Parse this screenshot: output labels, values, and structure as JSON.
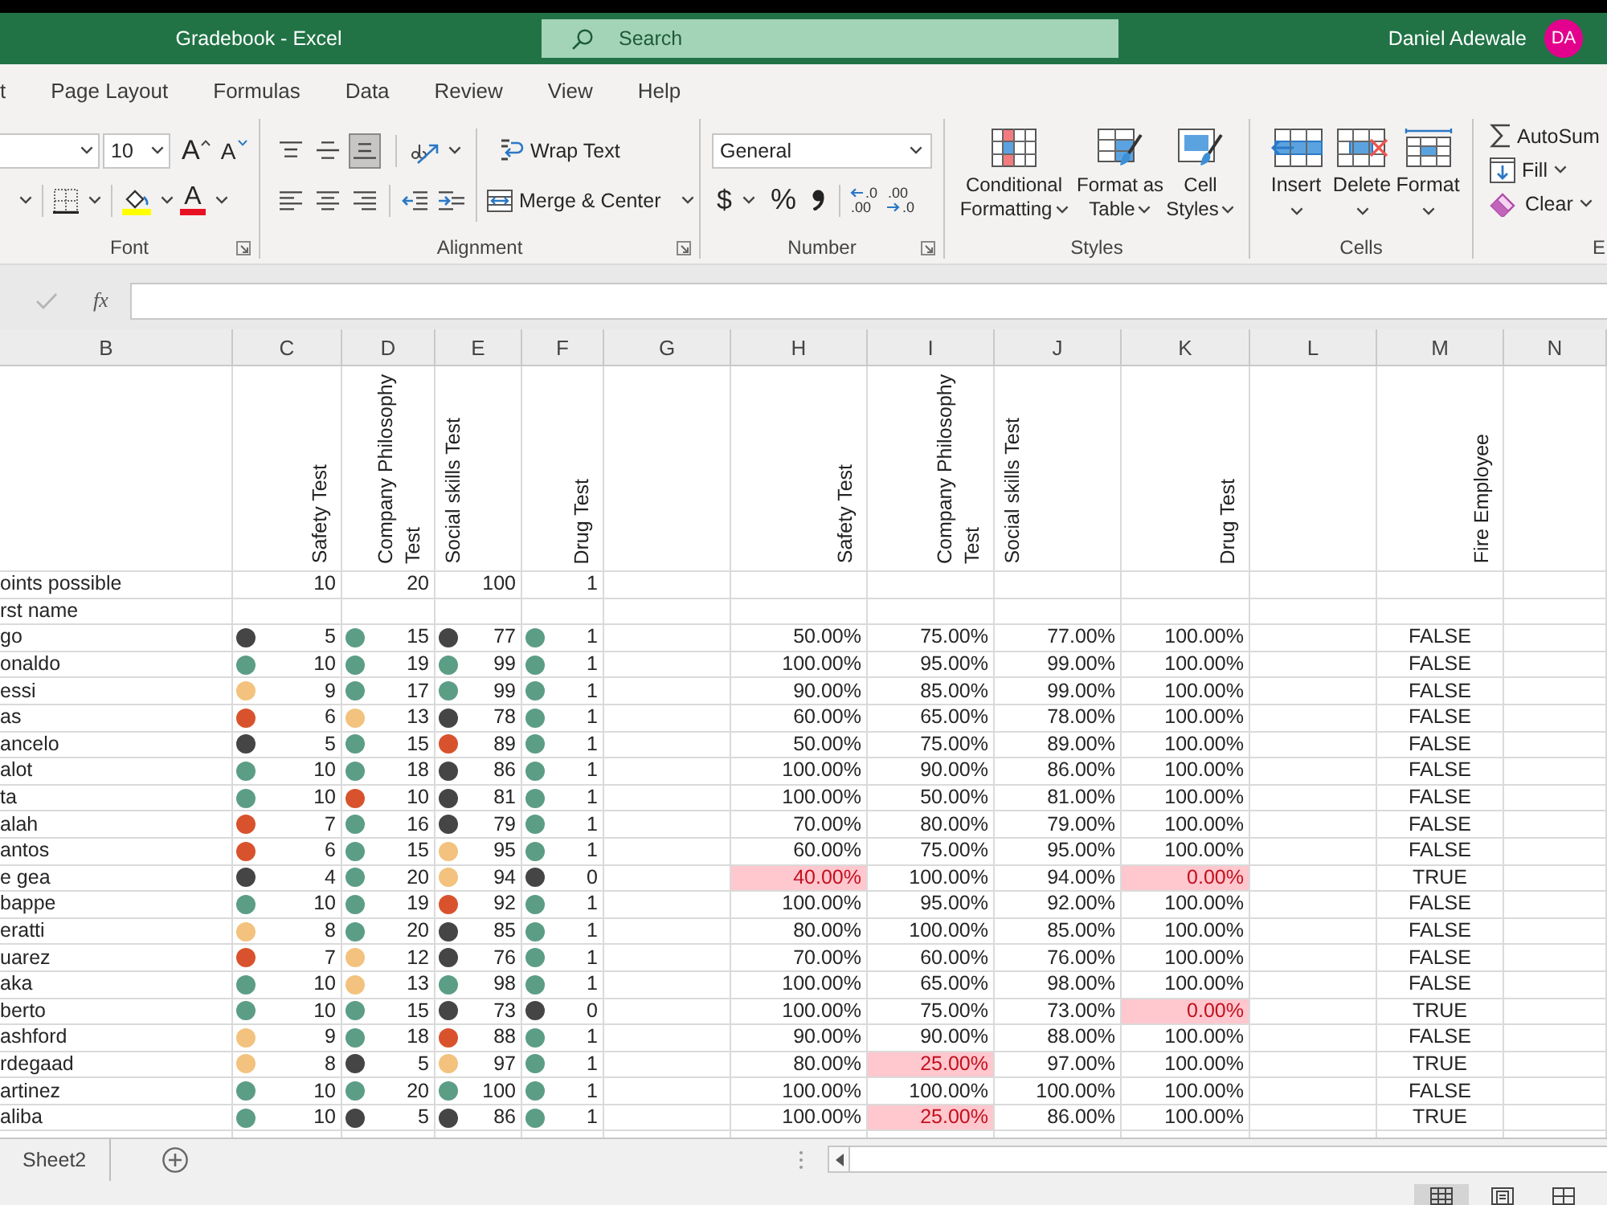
{
  "window": {
    "title": "Gradebook - Excel",
    "search": {
      "placeholder": "Search"
    },
    "user": {
      "name": "Daniel Adewale",
      "initials": "DA"
    }
  },
  "menu_tabs": [
    "t",
    "Page Layout",
    "Formulas",
    "Data",
    "Review",
    "View",
    "Help"
  ],
  "ribbon": {
    "font": {
      "label": "Font",
      "size": "10",
      "grow": "A",
      "shrink": "A",
      "font_color": "A"
    },
    "alignment": {
      "label": "Alignment",
      "vertical": [
        {
          "kind": "top",
          "selected": false
        },
        {
          "kind": "middle",
          "selected": false
        },
        {
          "kind": "bottom",
          "selected": true
        }
      ],
      "wrap_text": "Wrap Text",
      "merge": "Merge & Center"
    },
    "number": {
      "label": "Number",
      "format": "General",
      "currency": "$",
      "percent": "%",
      "decimals": [
        {
          "kind": "increase",
          "top": ".0",
          "bottom": ".00"
        },
        {
          "kind": "decrease",
          "top": ".00",
          "bottom": ".0"
        }
      ]
    },
    "styles": {
      "label": "Styles",
      "buttons": [
        {
          "kind": "conditional",
          "label": "Conditional Formatting"
        },
        {
          "kind": "table",
          "label": "Format as Table"
        },
        {
          "kind": "cell",
          "label": "Cell Styles"
        }
      ]
    },
    "cells": {
      "label": "Cells",
      "buttons": [
        {
          "kind": "insert",
          "label": "Insert"
        },
        {
          "kind": "delete",
          "label": "Delete"
        },
        {
          "kind": "format",
          "label": "Format"
        }
      ]
    },
    "editing": {
      "label": "E",
      "buttons": [
        {
          "kind": "autosum",
          "label": "AutoSum"
        },
        {
          "kind": "fill",
          "label": "Fill"
        },
        {
          "kind": "clear",
          "label": "Clear"
        }
      ]
    }
  },
  "formula_bar": {
    "function_label": "fx"
  },
  "sheet": {
    "columns": [
      "B",
      "C",
      "D",
      "E",
      "F",
      "G",
      "H",
      "I",
      "J",
      "K",
      "L",
      "M",
      "N"
    ],
    "score_headers": [
      "Safety Test",
      "Company Philosophy Test",
      "Social skills Test",
      "Drug Test"
    ],
    "percent_headers": [
      "Safety Test",
      "Company Philosophy Test",
      "Social skills Test",
      "Drug Test"
    ],
    "result_header": "Fire Employee",
    "points_row": {
      "label": "oints possible",
      "values": [
        "10",
        "20",
        "100",
        "1"
      ]
    },
    "name_row": {
      "label": "rst name"
    },
    "rows": [
      {
        "name": "go",
        "scores": [
          {
            "value": "5",
            "color": "#454545"
          },
          {
            "value": "15",
            "color": "#5c9d86"
          },
          {
            "value": "77",
            "color": "#454545"
          },
          {
            "value": "1",
            "color": "#5c9d86"
          }
        ],
        "percents": [
          {
            "text": "50.00%",
            "flagged": false
          },
          {
            "text": "75.00%",
            "flagged": false
          },
          {
            "text": "77.00%",
            "flagged": false
          },
          {
            "text": "100.00%",
            "flagged": false
          }
        ],
        "result": "FALSE"
      },
      {
        "name": "onaldo",
        "scores": [
          {
            "value": "10",
            "color": "#5c9d86"
          },
          {
            "value": "19",
            "color": "#5c9d86"
          },
          {
            "value": "99",
            "color": "#5c9d86"
          },
          {
            "value": "1",
            "color": "#5c9d86"
          }
        ],
        "percents": [
          {
            "text": "100.00%",
            "flagged": false
          },
          {
            "text": "95.00%",
            "flagged": false
          },
          {
            "text": "99.00%",
            "flagged": false
          },
          {
            "text": "100.00%",
            "flagged": false
          }
        ],
        "result": "FALSE"
      },
      {
        "name": "essi",
        "scores": [
          {
            "value": "9",
            "color": "#f2c27e"
          },
          {
            "value": "17",
            "color": "#5c9d86"
          },
          {
            "value": "99",
            "color": "#5c9d86"
          },
          {
            "value": "1",
            "color": "#5c9d86"
          }
        ],
        "percents": [
          {
            "text": "90.00%",
            "flagged": false
          },
          {
            "text": "85.00%",
            "flagged": false
          },
          {
            "text": "99.00%",
            "flagged": false
          },
          {
            "text": "100.00%",
            "flagged": false
          }
        ],
        "result": "FALSE"
      },
      {
        "name": "as",
        "scores": [
          {
            "value": "6",
            "color": "#d8532d"
          },
          {
            "value": "13",
            "color": "#f2c27e"
          },
          {
            "value": "78",
            "color": "#454545"
          },
          {
            "value": "1",
            "color": "#5c9d86"
          }
        ],
        "percents": [
          {
            "text": "60.00%",
            "flagged": false
          },
          {
            "text": "65.00%",
            "flagged": false
          },
          {
            "text": "78.00%",
            "flagged": false
          },
          {
            "text": "100.00%",
            "flagged": false
          }
        ],
        "result": "FALSE"
      },
      {
        "name": "ancelo",
        "scores": [
          {
            "value": "5",
            "color": "#454545"
          },
          {
            "value": "15",
            "color": "#5c9d86"
          },
          {
            "value": "89",
            "color": "#d8532d"
          },
          {
            "value": "1",
            "color": "#5c9d86"
          }
        ],
        "percents": [
          {
            "text": "50.00%",
            "flagged": false
          },
          {
            "text": "75.00%",
            "flagged": false
          },
          {
            "text": "89.00%",
            "flagged": false
          },
          {
            "text": "100.00%",
            "flagged": false
          }
        ],
        "result": "FALSE"
      },
      {
        "name": "alot",
        "scores": [
          {
            "value": "10",
            "color": "#5c9d86"
          },
          {
            "value": "18",
            "color": "#5c9d86"
          },
          {
            "value": "86",
            "color": "#454545"
          },
          {
            "value": "1",
            "color": "#5c9d86"
          }
        ],
        "percents": [
          {
            "text": "100.00%",
            "flagged": false
          },
          {
            "text": "90.00%",
            "flagged": false
          },
          {
            "text": "86.00%",
            "flagged": false
          },
          {
            "text": "100.00%",
            "flagged": false
          }
        ],
        "result": "FALSE"
      },
      {
        "name": "ta",
        "scores": [
          {
            "value": "10",
            "color": "#5c9d86"
          },
          {
            "value": "10",
            "color": "#d8532d"
          },
          {
            "value": "81",
            "color": "#454545"
          },
          {
            "value": "1",
            "color": "#5c9d86"
          }
        ],
        "percents": [
          {
            "text": "100.00%",
            "flagged": false
          },
          {
            "text": "50.00%",
            "flagged": false
          },
          {
            "text": "81.00%",
            "flagged": false
          },
          {
            "text": "100.00%",
            "flagged": false
          }
        ],
        "result": "FALSE"
      },
      {
        "name": "alah",
        "scores": [
          {
            "value": "7",
            "color": "#d8532d"
          },
          {
            "value": "16",
            "color": "#5c9d86"
          },
          {
            "value": "79",
            "color": "#454545"
          },
          {
            "value": "1",
            "color": "#5c9d86"
          }
        ],
        "percents": [
          {
            "text": "70.00%",
            "flagged": false
          },
          {
            "text": "80.00%",
            "flagged": false
          },
          {
            "text": "79.00%",
            "flagged": false
          },
          {
            "text": "100.00%",
            "flagged": false
          }
        ],
        "result": "FALSE"
      },
      {
        "name": "antos",
        "scores": [
          {
            "value": "6",
            "color": "#d8532d"
          },
          {
            "value": "15",
            "color": "#5c9d86"
          },
          {
            "value": "95",
            "color": "#f2c27e"
          },
          {
            "value": "1",
            "color": "#5c9d86"
          }
        ],
        "percents": [
          {
            "text": "60.00%",
            "flagged": false
          },
          {
            "text": "75.00%",
            "flagged": false
          },
          {
            "text": "95.00%",
            "flagged": false
          },
          {
            "text": "100.00%",
            "flagged": false
          }
        ],
        "result": "FALSE"
      },
      {
        "name": "e gea",
        "scores": [
          {
            "value": "4",
            "color": "#454545"
          },
          {
            "value": "20",
            "color": "#5c9d86"
          },
          {
            "value": "94",
            "color": "#f2c27e"
          },
          {
            "value": "0",
            "color": "#454545"
          }
        ],
        "percents": [
          {
            "text": "40.00%",
            "flagged": true
          },
          {
            "text": "100.00%",
            "flagged": false
          },
          {
            "text": "94.00%",
            "flagged": false
          },
          {
            "text": "0.00%",
            "flagged": true
          }
        ],
        "result": "TRUE"
      },
      {
        "name": "bappe",
        "scores": [
          {
            "value": "10",
            "color": "#5c9d86"
          },
          {
            "value": "19",
            "color": "#5c9d86"
          },
          {
            "value": "92",
            "color": "#d8532d"
          },
          {
            "value": "1",
            "color": "#5c9d86"
          }
        ],
        "percents": [
          {
            "text": "100.00%",
            "flagged": false
          },
          {
            "text": "95.00%",
            "flagged": false
          },
          {
            "text": "92.00%",
            "flagged": false
          },
          {
            "text": "100.00%",
            "flagged": false
          }
        ],
        "result": "FALSE"
      },
      {
        "name": "eratti",
        "scores": [
          {
            "value": "8",
            "color": "#f2c27e"
          },
          {
            "value": "20",
            "color": "#5c9d86"
          },
          {
            "value": "85",
            "color": "#454545"
          },
          {
            "value": "1",
            "color": "#5c9d86"
          }
        ],
        "percents": [
          {
            "text": "80.00%",
            "flagged": false
          },
          {
            "text": "100.00%",
            "flagged": false
          },
          {
            "text": "85.00%",
            "flagged": false
          },
          {
            "text": "100.00%",
            "flagged": false
          }
        ],
        "result": "FALSE"
      },
      {
        "name": "uarez",
        "scores": [
          {
            "value": "7",
            "color": "#d8532d"
          },
          {
            "value": "12",
            "color": "#f2c27e"
          },
          {
            "value": "76",
            "color": "#454545"
          },
          {
            "value": "1",
            "color": "#5c9d86"
          }
        ],
        "percents": [
          {
            "text": "70.00%",
            "flagged": false
          },
          {
            "text": "60.00%",
            "flagged": false
          },
          {
            "text": "76.00%",
            "flagged": false
          },
          {
            "text": "100.00%",
            "flagged": false
          }
        ],
        "result": "FALSE"
      },
      {
        "name": "aka",
        "scores": [
          {
            "value": "10",
            "color": "#5c9d86"
          },
          {
            "value": "13",
            "color": "#f2c27e"
          },
          {
            "value": "98",
            "color": "#5c9d86"
          },
          {
            "value": "1",
            "color": "#5c9d86"
          }
        ],
        "percents": [
          {
            "text": "100.00%",
            "flagged": false
          },
          {
            "text": "65.00%",
            "flagged": false
          },
          {
            "text": "98.00%",
            "flagged": false
          },
          {
            "text": "100.00%",
            "flagged": false
          }
        ],
        "result": "FALSE"
      },
      {
        "name": "berto",
        "scores": [
          {
            "value": "10",
            "color": "#5c9d86"
          },
          {
            "value": "15",
            "color": "#5c9d86"
          },
          {
            "value": "73",
            "color": "#454545"
          },
          {
            "value": "0",
            "color": "#454545"
          }
        ],
        "percents": [
          {
            "text": "100.00%",
            "flagged": false
          },
          {
            "text": "75.00%",
            "flagged": false
          },
          {
            "text": "73.00%",
            "flagged": false
          },
          {
            "text": "0.00%",
            "flagged": true
          }
        ],
        "result": "TRUE"
      },
      {
        "name": "ashford",
        "scores": [
          {
            "value": "9",
            "color": "#f2c27e"
          },
          {
            "value": "18",
            "color": "#5c9d86"
          },
          {
            "value": "88",
            "color": "#d8532d"
          },
          {
            "value": "1",
            "color": "#5c9d86"
          }
        ],
        "percents": [
          {
            "text": "90.00%",
            "flagged": false
          },
          {
            "text": "90.00%",
            "flagged": false
          },
          {
            "text": "88.00%",
            "flagged": false
          },
          {
            "text": "100.00%",
            "flagged": false
          }
        ],
        "result": "FALSE"
      },
      {
        "name": "rdegaad",
        "scores": [
          {
            "value": "8",
            "color": "#f2c27e"
          },
          {
            "value": "5",
            "color": "#454545"
          },
          {
            "value": "97",
            "color": "#f2c27e"
          },
          {
            "value": "1",
            "color": "#5c9d86"
          }
        ],
        "percents": [
          {
            "text": "80.00%",
            "flagged": false
          },
          {
            "text": "25.00%",
            "flagged": true
          },
          {
            "text": "97.00%",
            "flagged": false
          },
          {
            "text": "100.00%",
            "flagged": false
          }
        ],
        "result": "TRUE"
      },
      {
        "name": "artinez",
        "scores": [
          {
            "value": "10",
            "color": "#5c9d86"
          },
          {
            "value": "20",
            "color": "#5c9d86"
          },
          {
            "value": "100",
            "color": "#5c9d86"
          },
          {
            "value": "1",
            "color": "#5c9d86"
          }
        ],
        "percents": [
          {
            "text": "100.00%",
            "flagged": false
          },
          {
            "text": "100.00%",
            "flagged": false
          },
          {
            "text": "100.00%",
            "flagged": false
          },
          {
            "text": "100.00%",
            "flagged": false
          }
        ],
        "result": "FALSE"
      },
      {
        "name": "aliba",
        "scores": [
          {
            "value": "10",
            "color": "#5c9d86"
          },
          {
            "value": "5",
            "color": "#454545"
          },
          {
            "value": "86",
            "color": "#454545"
          },
          {
            "value": "1",
            "color": "#5c9d86"
          }
        ],
        "percents": [
          {
            "text": "100.00%",
            "flagged": false
          },
          {
            "text": "25.00%",
            "flagged": true
          },
          {
            "text": "86.00%",
            "flagged": false
          },
          {
            "text": "100.00%",
            "flagged": false
          }
        ],
        "result": "TRUE"
      }
    ]
  },
  "sheet_tabs": [
    {
      "label": "Sheet2",
      "selected": false
    }
  ],
  "status_bar": {
    "views": [
      {
        "kind": "normal",
        "selected": true
      },
      {
        "kind": "page_layout",
        "selected": false
      },
      {
        "kind": "page_break",
        "selected": false
      }
    ]
  }
}
